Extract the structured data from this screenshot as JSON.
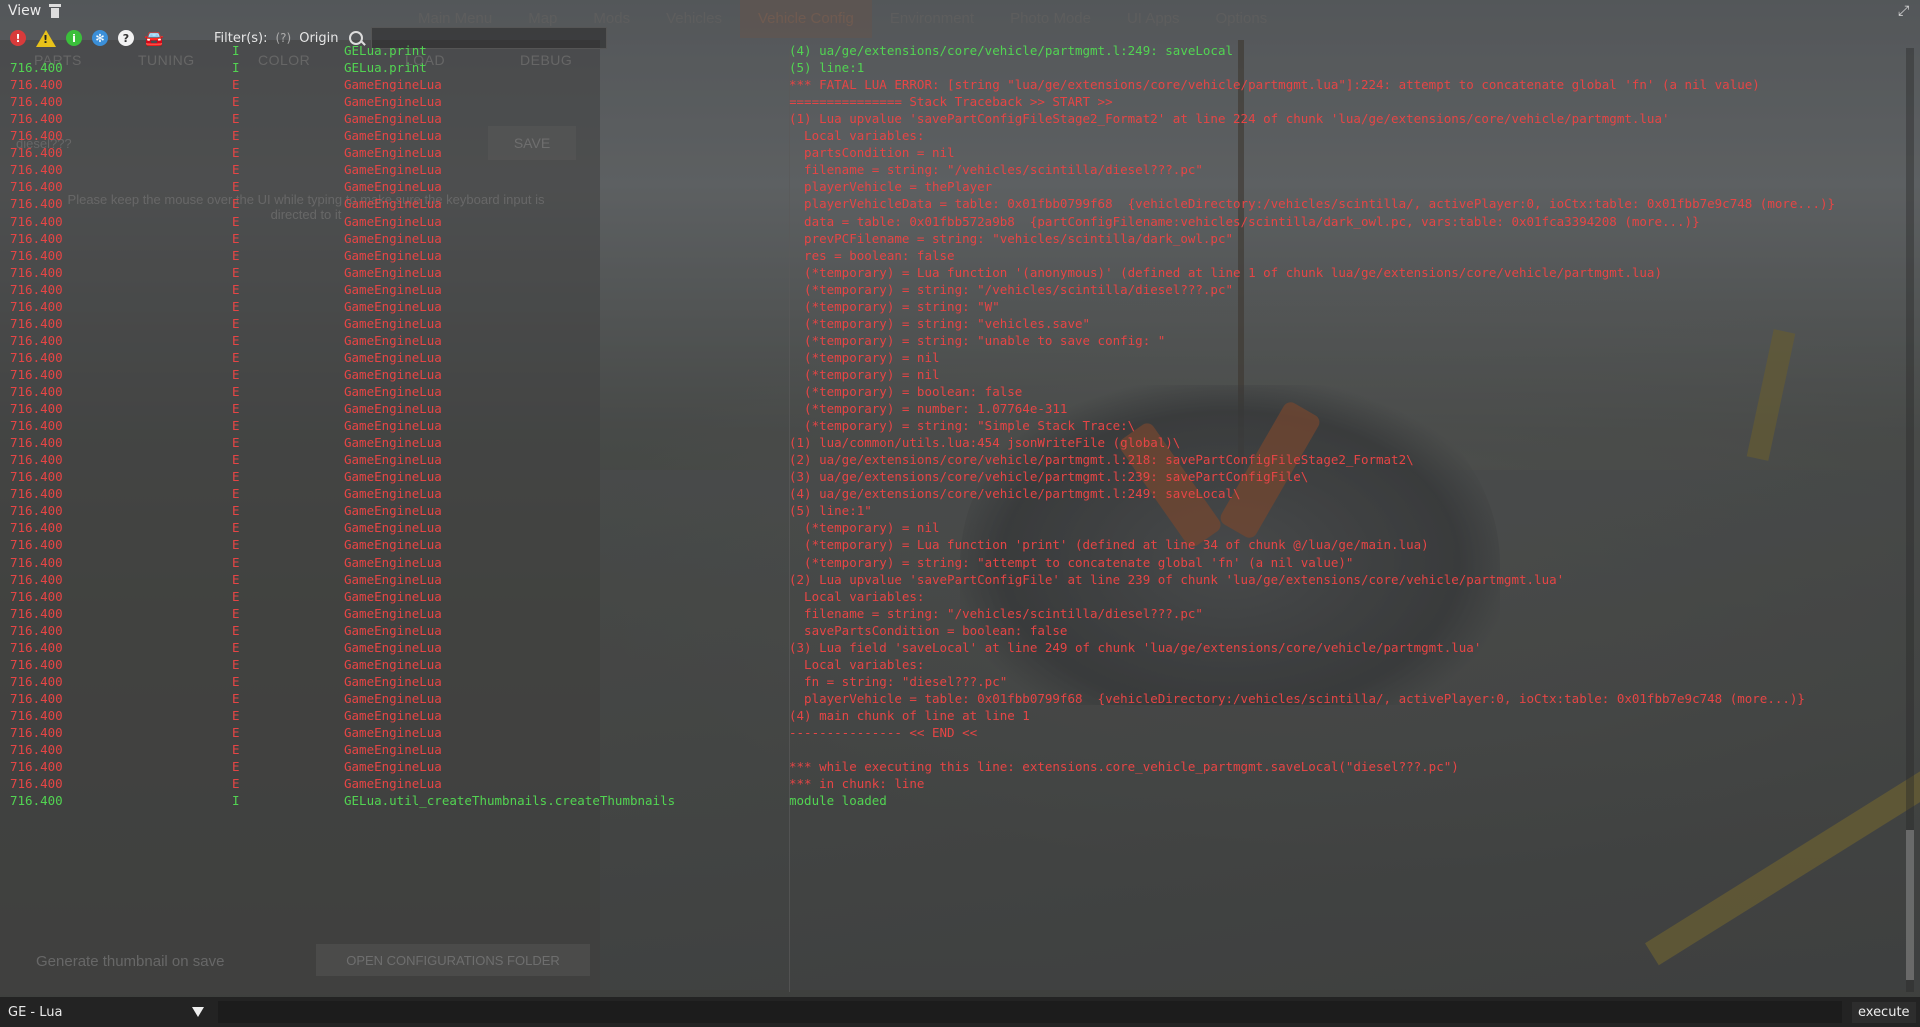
{
  "menubar": {
    "view": "View"
  },
  "background": {
    "menu_items": [
      "Main Menu",
      "Map",
      "Mods",
      "Vehicles",
      "Vehicle Config",
      "Environment",
      "Photo Mode",
      "UI Apps",
      "Options"
    ],
    "tabs": [
      "PARTS",
      "TUNING",
      "COLOR",
      "LOAD",
      "DEBUG"
    ],
    "save_label": "SAVE",
    "hint": "Please keep the mouse over the UI while typing to make sure the keyboard input is directed to it",
    "filename": "diesel???",
    "thumb_checkbox": "Generate thumbnail on save",
    "open_folder": "OPEN CONFIGURATIONS FOLDER"
  },
  "toolbar": {
    "filters_label": "Filter(s):",
    "filters_help": "(?)",
    "origin_label": "Origin",
    "filter_value": ""
  },
  "log_rows": [
    {
      "time": "",
      "level": "I",
      "origin": "GELua.print",
      "msg": "(4) ua/ge/extensions/core/vehicle/partmgmt.l:249: saveLocal"
    },
    {
      "time": "716.400",
      "level": "I",
      "origin": "GELua.print",
      "msg": "(5) line:1"
    },
    {
      "time": "716.400",
      "level": "E",
      "origin": "GameEngineLua",
      "msg": "*** FATAL LUA ERROR: [string \"lua/ge/extensions/core/vehicle/partmgmt.lua\"]:224: attempt to concatenate global 'fn' (a nil value)"
    },
    {
      "time": "716.400",
      "level": "E",
      "origin": "GameEngineLua",
      "msg": "=============== Stack Traceback >> START >>"
    },
    {
      "time": "716.400",
      "level": "E",
      "origin": "GameEngineLua",
      "msg": "(1) Lua upvalue 'savePartConfigFileStage2_Format2' at line 224 of chunk 'lua/ge/extensions/core/vehicle/partmgmt.lua'"
    },
    {
      "time": "716.400",
      "level": "E",
      "origin": "GameEngineLua",
      "msg": "  Local variables:"
    },
    {
      "time": "716.400",
      "level": "E",
      "origin": "GameEngineLua",
      "msg": "  partsCondition = nil"
    },
    {
      "time": "716.400",
      "level": "E",
      "origin": "GameEngineLua",
      "msg": "  filename = string: \"/vehicles/scintilla/diesel???.pc\""
    },
    {
      "time": "716.400",
      "level": "E",
      "origin": "GameEngineLua",
      "msg": "  playerVehicle = thePlayer"
    },
    {
      "time": "716.400",
      "level": "E",
      "origin": "GameEngineLua",
      "msg": "  playerVehicleData = table: 0x01fbb0799f68  {vehicleDirectory:/vehicles/scintilla/, activePlayer:0, ioCtx:table: 0x01fbb7e9c748 (more...)}"
    },
    {
      "time": "716.400",
      "level": "E",
      "origin": "GameEngineLua",
      "msg": "  data = table: 0x01fbb572a9b8  {partConfigFilename:vehicles/scintilla/dark_owl.pc, vars:table: 0x01fca3394208 (more...)}"
    },
    {
      "time": "716.400",
      "level": "E",
      "origin": "GameEngineLua",
      "msg": "  prevPCFilename = string: \"vehicles/scintilla/dark_owl.pc\""
    },
    {
      "time": "716.400",
      "level": "E",
      "origin": "GameEngineLua",
      "msg": "  res = boolean: false"
    },
    {
      "time": "716.400",
      "level": "E",
      "origin": "GameEngineLua",
      "msg": "  (*temporary) = Lua function '(anonymous)' (defined at line 1 of chunk lua/ge/extensions/core/vehicle/partmgmt.lua)"
    },
    {
      "time": "716.400",
      "level": "E",
      "origin": "GameEngineLua",
      "msg": "  (*temporary) = string: \"/vehicles/scintilla/diesel???.pc\""
    },
    {
      "time": "716.400",
      "level": "E",
      "origin": "GameEngineLua",
      "msg": "  (*temporary) = string: \"W\""
    },
    {
      "time": "716.400",
      "level": "E",
      "origin": "GameEngineLua",
      "msg": "  (*temporary) = string: \"vehicles.save\""
    },
    {
      "time": "716.400",
      "level": "E",
      "origin": "GameEngineLua",
      "msg": "  (*temporary) = string: \"unable to save config: \""
    },
    {
      "time": "716.400",
      "level": "E",
      "origin": "GameEngineLua",
      "msg": "  (*temporary) = nil"
    },
    {
      "time": "716.400",
      "level": "E",
      "origin": "GameEngineLua",
      "msg": "  (*temporary) = nil"
    },
    {
      "time": "716.400",
      "level": "E",
      "origin": "GameEngineLua",
      "msg": "  (*temporary) = boolean: false"
    },
    {
      "time": "716.400",
      "level": "E",
      "origin": "GameEngineLua",
      "msg": "  (*temporary) = number: 1.07764e-311"
    },
    {
      "time": "716.400",
      "level": "E",
      "origin": "GameEngineLua",
      "msg": "  (*temporary) = string: \"Simple Stack Trace:\\"
    },
    {
      "time": "716.400",
      "level": "E",
      "origin": "GameEngineLua",
      "msg": "(1) lua/common/utils.lua:454 jsonWriteFile (global)\\"
    },
    {
      "time": "716.400",
      "level": "E",
      "origin": "GameEngineLua",
      "msg": "(2) ua/ge/extensions/core/vehicle/partmgmt.l:218: savePartConfigFileStage2_Format2\\"
    },
    {
      "time": "716.400",
      "level": "E",
      "origin": "GameEngineLua",
      "msg": "(3) ua/ge/extensions/core/vehicle/partmgmt.l:239: savePartConfigFile\\"
    },
    {
      "time": "716.400",
      "level": "E",
      "origin": "GameEngineLua",
      "msg": "(4) ua/ge/extensions/core/vehicle/partmgmt.l:249: saveLocal\\"
    },
    {
      "time": "716.400",
      "level": "E",
      "origin": "GameEngineLua",
      "msg": "(5) line:1\""
    },
    {
      "time": "716.400",
      "level": "E",
      "origin": "GameEngineLua",
      "msg": "  (*temporary) = nil"
    },
    {
      "time": "716.400",
      "level": "E",
      "origin": "GameEngineLua",
      "msg": "  (*temporary) = Lua function 'print' (defined at line 34 of chunk @/lua/ge/main.lua)"
    },
    {
      "time": "716.400",
      "level": "E",
      "origin": "GameEngineLua",
      "msg": "  (*temporary) = string: \"attempt to concatenate global 'fn' (a nil value)\""
    },
    {
      "time": "716.400",
      "level": "E",
      "origin": "GameEngineLua",
      "msg": "(2) Lua upvalue 'savePartConfigFile' at line 239 of chunk 'lua/ge/extensions/core/vehicle/partmgmt.lua'"
    },
    {
      "time": "716.400",
      "level": "E",
      "origin": "GameEngineLua",
      "msg": "  Local variables:"
    },
    {
      "time": "716.400",
      "level": "E",
      "origin": "GameEngineLua",
      "msg": "  filename = string: \"/vehicles/scintilla/diesel???.pc\""
    },
    {
      "time": "716.400",
      "level": "E",
      "origin": "GameEngineLua",
      "msg": "  savePartsCondition = boolean: false"
    },
    {
      "time": "716.400",
      "level": "E",
      "origin": "GameEngineLua",
      "msg": "(3) Lua field 'saveLocal' at line 249 of chunk 'lua/ge/extensions/core/vehicle/partmgmt.lua'"
    },
    {
      "time": "716.400",
      "level": "E",
      "origin": "GameEngineLua",
      "msg": "  Local variables:"
    },
    {
      "time": "716.400",
      "level": "E",
      "origin": "GameEngineLua",
      "msg": "  fn = string: \"diesel???.pc\""
    },
    {
      "time": "716.400",
      "level": "E",
      "origin": "GameEngineLua",
      "msg": "  playerVehicle = table: 0x01fbb0799f68  {vehicleDirectory:/vehicles/scintilla/, activePlayer:0, ioCtx:table: 0x01fbb7e9c748 (more...)}"
    },
    {
      "time": "716.400",
      "level": "E",
      "origin": "GameEngineLua",
      "msg": "(4) main chunk of line at line 1"
    },
    {
      "time": "716.400",
      "level": "E",
      "origin": "GameEngineLua",
      "msg": "--------------- << END <<"
    },
    {
      "time": "716.400",
      "level": "E",
      "origin": "GameEngineLua",
      "msg": ""
    },
    {
      "time": "716.400",
      "level": "E",
      "origin": "GameEngineLua",
      "msg": "*** while executing this line: extensions.core_vehicle_partmgmt.saveLocal(\"diesel???.pc\")"
    },
    {
      "time": "716.400",
      "level": "E",
      "origin": "GameEngineLua",
      "msg": "*** in chunk: line"
    },
    {
      "time": "716.400",
      "level": "I",
      "origin": "GELua.util_createThumbnails.createThumbnails",
      "msg": "module loaded"
    }
  ],
  "cmdbar": {
    "context": "GE - Lua",
    "command": "",
    "execute": "execute"
  },
  "colors": {
    "info": "#52d452",
    "error": "#e64545"
  }
}
